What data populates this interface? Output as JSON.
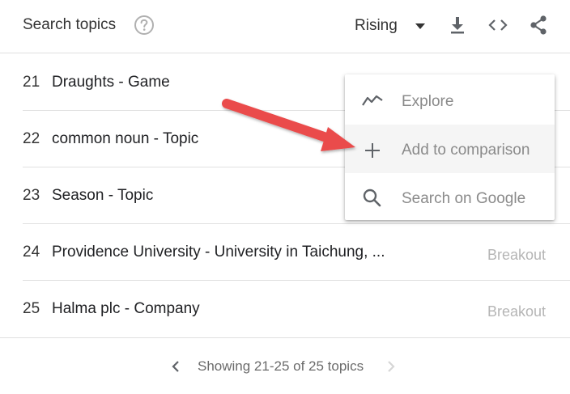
{
  "header": {
    "title": "Search topics",
    "filter_label": "Rising"
  },
  "rows": [
    {
      "rank": "21",
      "label": "Draughts - Game",
      "value": ""
    },
    {
      "rank": "22",
      "label": "common noun - Topic",
      "value": ""
    },
    {
      "rank": "23",
      "label": "Season - Topic",
      "value": ""
    },
    {
      "rank": "24",
      "label": "Providence University - University in Taichung, ...",
      "value": "Breakout"
    },
    {
      "rank": "25",
      "label": "Halma plc - Company",
      "value": "Breakout"
    }
  ],
  "pagination": {
    "text": "Showing 21-25 of 25 topics"
  },
  "context_menu": {
    "items": [
      {
        "label": "Explore",
        "icon": "trending-icon"
      },
      {
        "label": "Add to comparison",
        "icon": "plus-icon"
      },
      {
        "label": "Search on Google",
        "icon": "search-icon"
      }
    ]
  },
  "colors": {
    "annotation_arrow": "#ea4c4c",
    "muted_text": "#b5b5b5",
    "divider": "#e0e0e0"
  }
}
